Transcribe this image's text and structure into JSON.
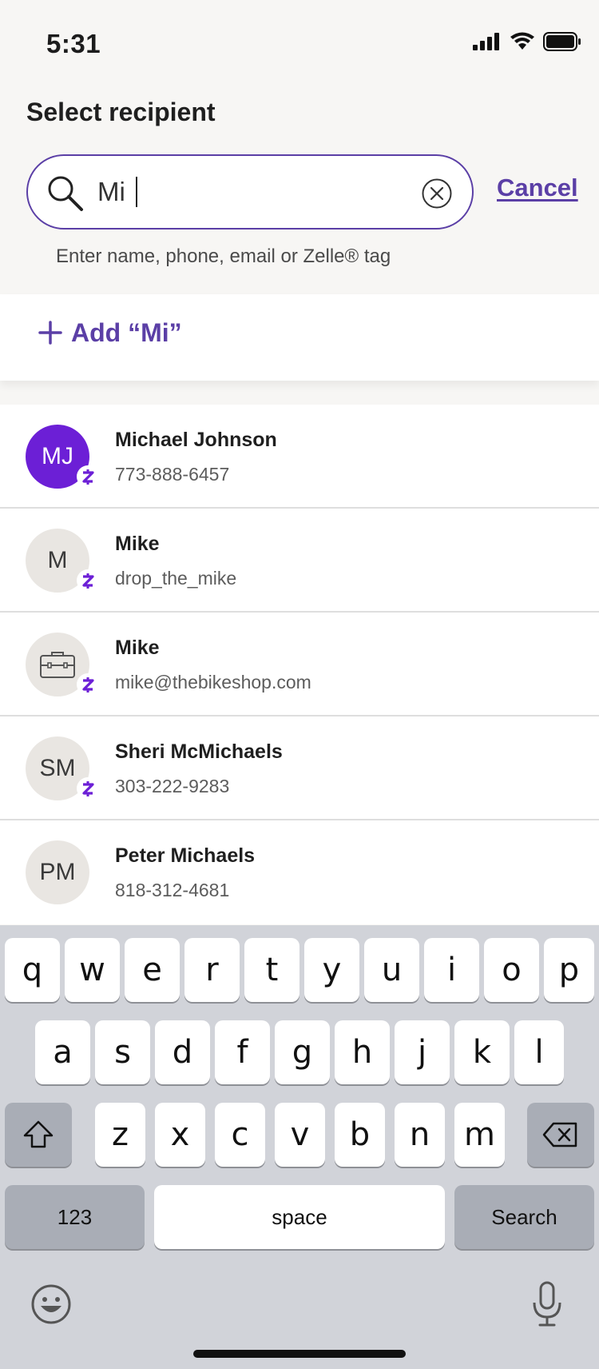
{
  "status": {
    "time": "5:31"
  },
  "header": {
    "title": "Select recipient",
    "search_value": "Mi",
    "cancel_label": "Cancel",
    "hint": "Enter name, phone, email or Zelle® tag"
  },
  "add": {
    "label": "Add “Mi”"
  },
  "contacts": [
    {
      "initials": "MJ",
      "name": "Michael Johnson",
      "detail": "773-888-6457",
      "zelle": true,
      "avatar_style": "purple"
    },
    {
      "initials": "M",
      "name": "Mike",
      "detail": "drop_the_mike",
      "zelle": true,
      "avatar_style": "gray"
    },
    {
      "initials": "",
      "icon": "briefcase-icon",
      "name": "Mike",
      "detail": "mike@thebikeshop.com",
      "zelle": true,
      "avatar_style": "gray"
    },
    {
      "initials": "SM",
      "name": "Sheri McMichaels",
      "detail": "303-222-9283",
      "zelle": true,
      "avatar_style": "gray"
    },
    {
      "initials": "PM",
      "name": "Peter Michaels",
      "detail": "818-312-4681",
      "zelle": false,
      "avatar_style": "gray"
    }
  ],
  "keyboard": {
    "row1": [
      "q",
      "w",
      "e",
      "r",
      "t",
      "y",
      "u",
      "i",
      "o",
      "p"
    ],
    "row2": [
      "a",
      "s",
      "d",
      "f",
      "g",
      "h",
      "j",
      "k",
      "l"
    ],
    "row3": [
      "z",
      "x",
      "c",
      "v",
      "b",
      "n",
      "m"
    ],
    "numbers_label": "123",
    "space_label": "space",
    "search_label": "Search"
  },
  "colors": {
    "accent": "#5b3fa6",
    "zelle": "#6c1fd6"
  }
}
